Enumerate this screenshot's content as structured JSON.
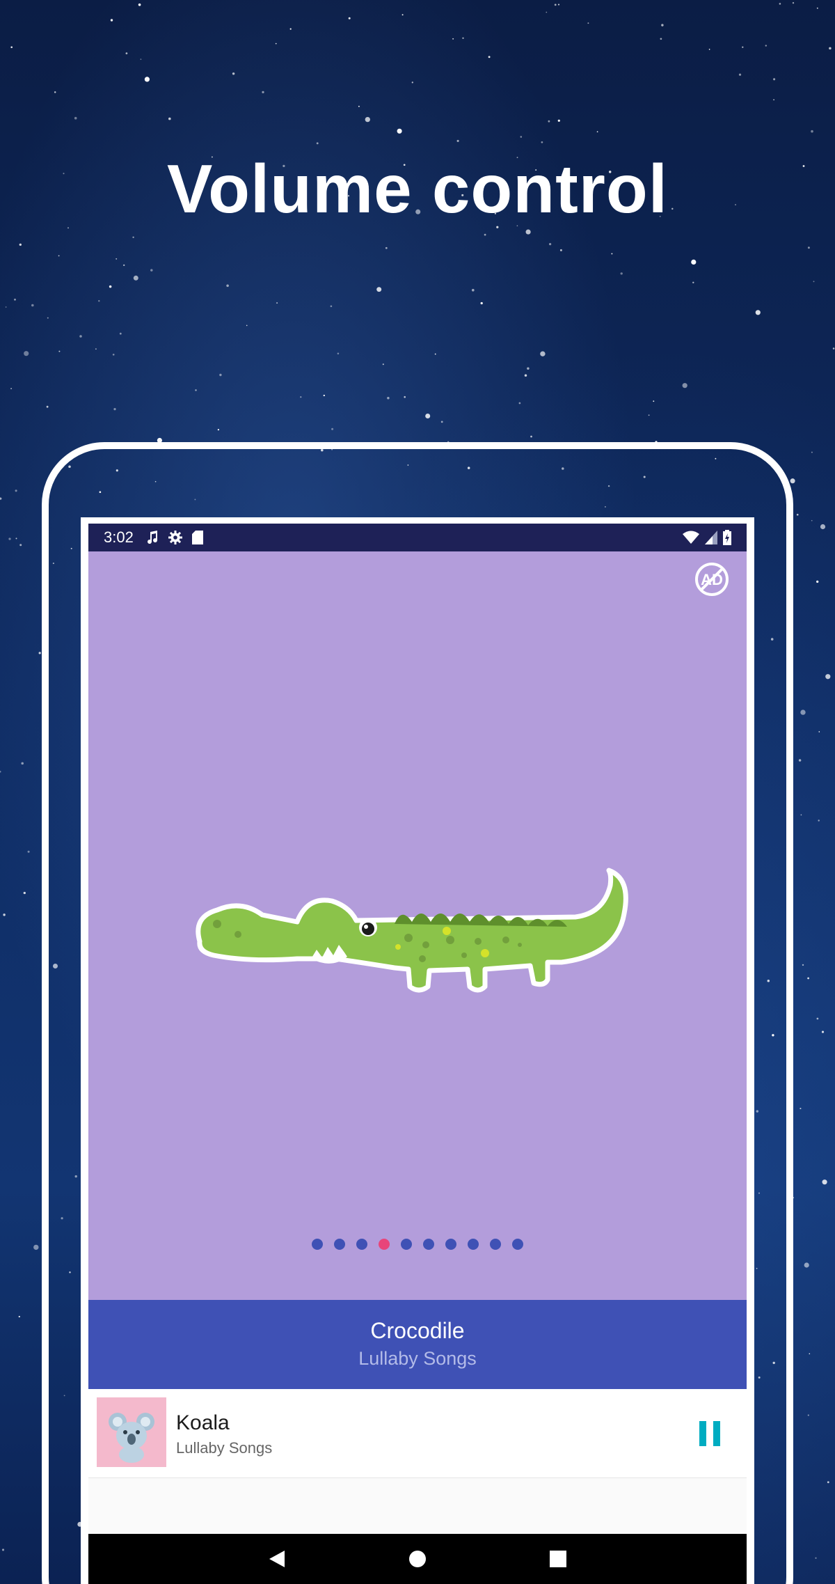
{
  "headline": "Volume control",
  "status_bar": {
    "time": "3:02",
    "left_icons": [
      "music-note-icon",
      "gear-icon",
      "sd-card-icon"
    ],
    "right_icons": [
      "wifi-icon",
      "signal-icon",
      "battery-charging-icon"
    ]
  },
  "hero": {
    "ad_button_icon": "no-ads-icon",
    "ad_button_text": "AD",
    "illustration": "crocodile",
    "background_color": "#b39ddb",
    "pagination": {
      "total": 10,
      "active_index": 3
    }
  },
  "now_playing": {
    "title": "Crocodile",
    "subtitle": "Lullaby Songs",
    "background_color": "#3f51b5"
  },
  "mini_player": {
    "thumbnail": "koala",
    "title": "Koala",
    "subtitle": "Lullaby Songs",
    "control_icon": "pause-icon",
    "accent_color": "#00acc1"
  },
  "nav_bar": {
    "buttons": [
      "back-icon",
      "home-icon",
      "recents-icon"
    ]
  }
}
